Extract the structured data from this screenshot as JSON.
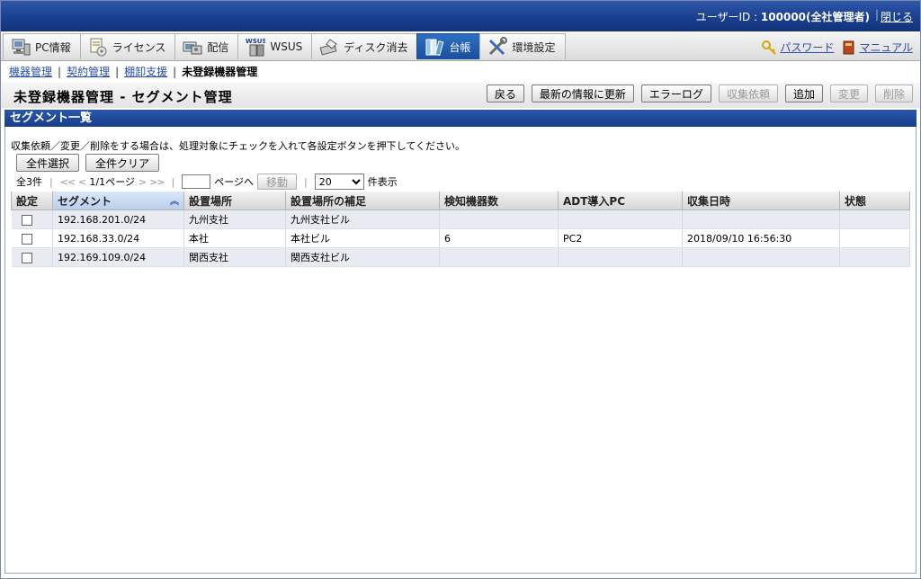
{
  "header": {
    "user_label": "ユーザーID : ",
    "user_value": "100000(全社管理者)",
    "close": "閉じる"
  },
  "tabs": [
    {
      "label": "PC情報",
      "icon": "pc-icon"
    },
    {
      "label": "ライセンス",
      "icon": "license-icon"
    },
    {
      "label": "配信",
      "icon": "delivery-icon"
    },
    {
      "label": "WSUS",
      "icon": "wsus-icon"
    },
    {
      "label": "ディスク消去",
      "icon": "disk-erase-icon"
    },
    {
      "label": "台帳",
      "icon": "ledger-icon",
      "active": true
    },
    {
      "label": "環境設定",
      "icon": "settings-icon"
    }
  ],
  "menu_right": {
    "password": "パスワード",
    "manual": "マニュアル"
  },
  "breadcrumb": {
    "items": [
      "機器管理",
      "契約管理",
      "棚卸支援"
    ],
    "current": "未登録機器管理"
  },
  "title": "未登録機器管理 - セグメント管理",
  "buttons": {
    "back": "戻る",
    "refresh": "最新の情報に更新",
    "error_log": "エラーログ",
    "collect": "収集依頼",
    "add": "追加",
    "change": "変更",
    "delete": "削除"
  },
  "section_title": "セグメント一覧",
  "instruction": "収集依頼／変更／削除をする場合は、処理対象にチェックを入れて各設定ボタンを押下してください。",
  "select_all": "全件選択",
  "clear_all": "全件クリア",
  "pager": {
    "total": "全3件",
    "first": "<<",
    "prev": "<",
    "page_info": "1/1ページ",
    "next": ">",
    "last": ">>",
    "page_input": "",
    "goto_label": "ページへ",
    "move": "移動",
    "per_page": "20",
    "per_page_options": [
      "20"
    ],
    "per_page_suffix": "件表示"
  },
  "table": {
    "columns": [
      "設定",
      "セグメント",
      "設置場所",
      "設置場所の補足",
      "検知機器数",
      "ADT導入PC",
      "収集日時",
      "状態"
    ],
    "rows": [
      {
        "segment": "192.168.201.0/24",
        "place": "九州支社",
        "place_note": "九州支社ビル",
        "count": "",
        "adt_pc": "",
        "collected": "",
        "status": ""
      },
      {
        "segment": "192.168.33.0/24",
        "place": "本社",
        "place_note": "本社ビル",
        "count": "6",
        "adt_pc": "PC2",
        "collected": "2018/09/10 16:56:30",
        "status": ""
      },
      {
        "segment": "192.169.109.0/24",
        "place": "関西支社",
        "place_note": "関西支社ビル",
        "count": "",
        "adt_pc": "",
        "collected": "",
        "status": ""
      }
    ]
  }
}
